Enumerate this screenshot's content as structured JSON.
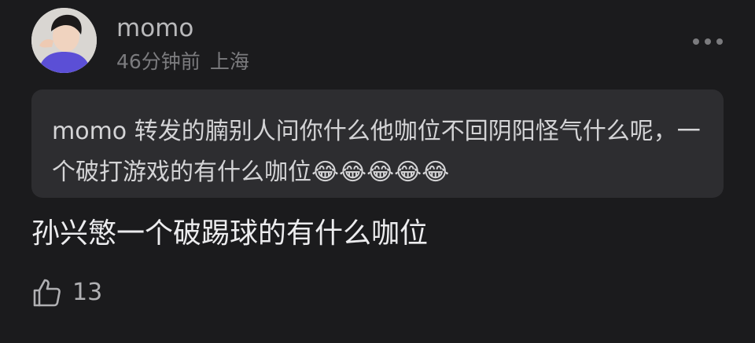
{
  "post": {
    "username": "momo",
    "time_ago": "46分钟前",
    "location": "上海",
    "more_icon": "more-horizontal-icon",
    "avatar_icon": "user-avatar"
  },
  "quote": {
    "text": "momo 转发的腩别人问你什么他咖位不回阴阳怪气什么呢，一个破打游戏的有什么咖位😂😂😂😂😂"
  },
  "reply": {
    "text": "孙兴慜一个破踢球的有什么咖位"
  },
  "actions": {
    "like_icon": "thumbs-up-icon",
    "like_count": "13"
  },
  "colors": {
    "background": "#1b1b1d",
    "quote_background": "#2d2d30",
    "username": "#b9b9bb",
    "meta": "#7b7b7e",
    "reply_text": "#ececee"
  }
}
